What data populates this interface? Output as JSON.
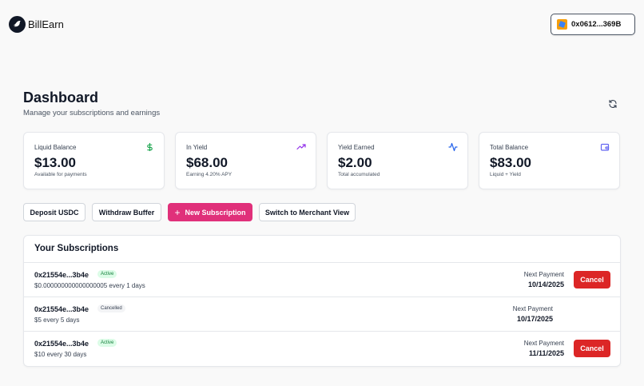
{
  "app": {
    "name": "BillEarn",
    "logo_icon": "bird-icon"
  },
  "wallet": {
    "address": "0x0612...369B"
  },
  "dashboard": {
    "title": "Dashboard",
    "subtitle": "Manage your subscriptions and earnings",
    "refresh_icon": "refresh-icon"
  },
  "stats": [
    {
      "label": "Liquid Balance",
      "value": "$13.00",
      "sub": "Available for payments",
      "icon": "dollar-icon",
      "color": "#16a34a"
    },
    {
      "label": "In Yield",
      "value": "$68.00",
      "sub": "Earning 4.20% APY",
      "icon": "trending-up-icon",
      "color": "#9333ea"
    },
    {
      "label": "Yield Earned",
      "value": "$2.00",
      "sub": "Total accumulated",
      "icon": "activity-icon",
      "color": "#2563eb"
    },
    {
      "label": "Total Balance",
      "value": "$83.00",
      "sub": "Liquid + Yield",
      "icon": "wallet-icon",
      "color": "#6366f1"
    }
  ],
  "actions": {
    "deposit": "Deposit USDC",
    "withdraw": "Withdraw Buffer",
    "new_subscription": "New Subscription",
    "merchant_view": "Switch to Merchant View"
  },
  "subscriptions": {
    "title": "Your Subscriptions",
    "next_payment_label": "Next Payment",
    "cancel_label": "Cancel",
    "items": [
      {
        "address": "0x21554e...3b4e",
        "status": "Active",
        "amount": "$0.000000000000000005 every 1 days",
        "next_payment": "10/14/2025"
      },
      {
        "address": "0x21554e...3b4e",
        "status": "Cancelled",
        "amount": "$5 every 5 days",
        "next_payment": "10/17/2025"
      },
      {
        "address": "0x21554e...3b4e",
        "status": "Active",
        "amount": "$10 every 30 days",
        "next_payment": "11/11/2025"
      }
    ]
  },
  "colors": {
    "primary": "#e0307a",
    "danger": "#dc2626",
    "active_badge": "#dcfce7",
    "cancelled_badge": "#f3f4f6"
  }
}
